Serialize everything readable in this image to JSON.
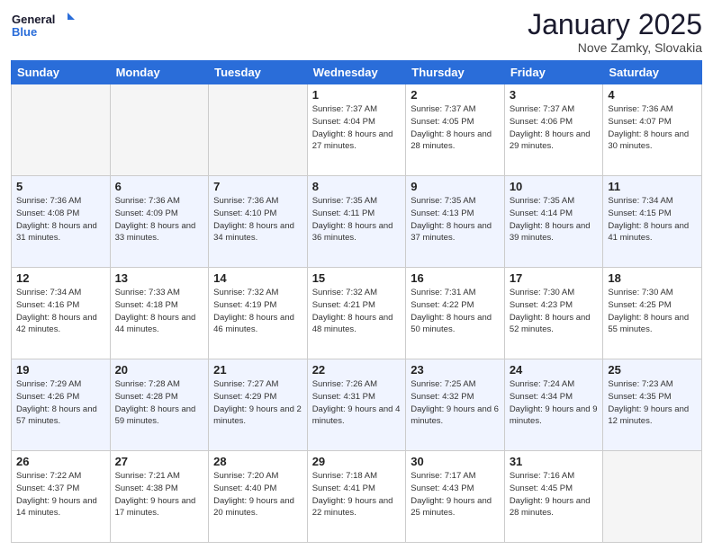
{
  "header": {
    "logo_line1": "General",
    "logo_line2": "Blue",
    "month": "January 2025",
    "location": "Nove Zamky, Slovakia"
  },
  "days_of_week": [
    "Sunday",
    "Monday",
    "Tuesday",
    "Wednesday",
    "Thursday",
    "Friday",
    "Saturday"
  ],
  "weeks": [
    {
      "row_class": "row-odd",
      "days": [
        {
          "num": "",
          "info": "",
          "empty": true
        },
        {
          "num": "",
          "info": "",
          "empty": true
        },
        {
          "num": "",
          "info": "",
          "empty": true
        },
        {
          "num": "1",
          "info": "Sunrise: 7:37 AM\nSunset: 4:04 PM\nDaylight: 8 hours and 27 minutes.",
          "empty": false
        },
        {
          "num": "2",
          "info": "Sunrise: 7:37 AM\nSunset: 4:05 PM\nDaylight: 8 hours and 28 minutes.",
          "empty": false
        },
        {
          "num": "3",
          "info": "Sunrise: 7:37 AM\nSunset: 4:06 PM\nDaylight: 8 hours and 29 minutes.",
          "empty": false
        },
        {
          "num": "4",
          "info": "Sunrise: 7:36 AM\nSunset: 4:07 PM\nDaylight: 8 hours and 30 minutes.",
          "empty": false
        }
      ]
    },
    {
      "row_class": "row-even",
      "days": [
        {
          "num": "5",
          "info": "Sunrise: 7:36 AM\nSunset: 4:08 PM\nDaylight: 8 hours and 31 minutes.",
          "empty": false
        },
        {
          "num": "6",
          "info": "Sunrise: 7:36 AM\nSunset: 4:09 PM\nDaylight: 8 hours and 33 minutes.",
          "empty": false
        },
        {
          "num": "7",
          "info": "Sunrise: 7:36 AM\nSunset: 4:10 PM\nDaylight: 8 hours and 34 minutes.",
          "empty": false
        },
        {
          "num": "8",
          "info": "Sunrise: 7:35 AM\nSunset: 4:11 PM\nDaylight: 8 hours and 36 minutes.",
          "empty": false
        },
        {
          "num": "9",
          "info": "Sunrise: 7:35 AM\nSunset: 4:13 PM\nDaylight: 8 hours and 37 minutes.",
          "empty": false
        },
        {
          "num": "10",
          "info": "Sunrise: 7:35 AM\nSunset: 4:14 PM\nDaylight: 8 hours and 39 minutes.",
          "empty": false
        },
        {
          "num": "11",
          "info": "Sunrise: 7:34 AM\nSunset: 4:15 PM\nDaylight: 8 hours and 41 minutes.",
          "empty": false
        }
      ]
    },
    {
      "row_class": "row-odd",
      "days": [
        {
          "num": "12",
          "info": "Sunrise: 7:34 AM\nSunset: 4:16 PM\nDaylight: 8 hours and 42 minutes.",
          "empty": false
        },
        {
          "num": "13",
          "info": "Sunrise: 7:33 AM\nSunset: 4:18 PM\nDaylight: 8 hours and 44 minutes.",
          "empty": false
        },
        {
          "num": "14",
          "info": "Sunrise: 7:32 AM\nSunset: 4:19 PM\nDaylight: 8 hours and 46 minutes.",
          "empty": false
        },
        {
          "num": "15",
          "info": "Sunrise: 7:32 AM\nSunset: 4:21 PM\nDaylight: 8 hours and 48 minutes.",
          "empty": false
        },
        {
          "num": "16",
          "info": "Sunrise: 7:31 AM\nSunset: 4:22 PM\nDaylight: 8 hours and 50 minutes.",
          "empty": false
        },
        {
          "num": "17",
          "info": "Sunrise: 7:30 AM\nSunset: 4:23 PM\nDaylight: 8 hours and 52 minutes.",
          "empty": false
        },
        {
          "num": "18",
          "info": "Sunrise: 7:30 AM\nSunset: 4:25 PM\nDaylight: 8 hours and 55 minutes.",
          "empty": false
        }
      ]
    },
    {
      "row_class": "row-even",
      "days": [
        {
          "num": "19",
          "info": "Sunrise: 7:29 AM\nSunset: 4:26 PM\nDaylight: 8 hours and 57 minutes.",
          "empty": false
        },
        {
          "num": "20",
          "info": "Sunrise: 7:28 AM\nSunset: 4:28 PM\nDaylight: 8 hours and 59 minutes.",
          "empty": false
        },
        {
          "num": "21",
          "info": "Sunrise: 7:27 AM\nSunset: 4:29 PM\nDaylight: 9 hours and 2 minutes.",
          "empty": false
        },
        {
          "num": "22",
          "info": "Sunrise: 7:26 AM\nSunset: 4:31 PM\nDaylight: 9 hours and 4 minutes.",
          "empty": false
        },
        {
          "num": "23",
          "info": "Sunrise: 7:25 AM\nSunset: 4:32 PM\nDaylight: 9 hours and 6 minutes.",
          "empty": false
        },
        {
          "num": "24",
          "info": "Sunrise: 7:24 AM\nSunset: 4:34 PM\nDaylight: 9 hours and 9 minutes.",
          "empty": false
        },
        {
          "num": "25",
          "info": "Sunrise: 7:23 AM\nSunset: 4:35 PM\nDaylight: 9 hours and 12 minutes.",
          "empty": false
        }
      ]
    },
    {
      "row_class": "row-odd",
      "days": [
        {
          "num": "26",
          "info": "Sunrise: 7:22 AM\nSunset: 4:37 PM\nDaylight: 9 hours and 14 minutes.",
          "empty": false
        },
        {
          "num": "27",
          "info": "Sunrise: 7:21 AM\nSunset: 4:38 PM\nDaylight: 9 hours and 17 minutes.",
          "empty": false
        },
        {
          "num": "28",
          "info": "Sunrise: 7:20 AM\nSunset: 4:40 PM\nDaylight: 9 hours and 20 minutes.",
          "empty": false
        },
        {
          "num": "29",
          "info": "Sunrise: 7:18 AM\nSunset: 4:41 PM\nDaylight: 9 hours and 22 minutes.",
          "empty": false
        },
        {
          "num": "30",
          "info": "Sunrise: 7:17 AM\nSunset: 4:43 PM\nDaylight: 9 hours and 25 minutes.",
          "empty": false
        },
        {
          "num": "31",
          "info": "Sunrise: 7:16 AM\nSunset: 4:45 PM\nDaylight: 9 hours and 28 minutes.",
          "empty": false
        },
        {
          "num": "",
          "info": "",
          "empty": true
        }
      ]
    }
  ]
}
